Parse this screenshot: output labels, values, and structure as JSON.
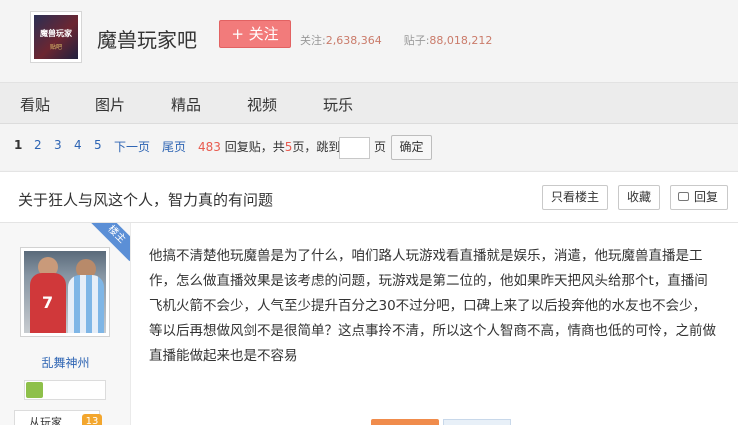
{
  "header": {
    "logo_text_main": "魔兽玩家",
    "logo_text_sub": "贴吧",
    "forum_name": "魔兽玩家吧",
    "follow_label": "+ 关注",
    "followers_label": "关注:",
    "followers_count": "2,638,364",
    "posts_label": "贴子:",
    "posts_count": "88,018,212"
  },
  "nav": {
    "tabs": [
      {
        "label": "看贴"
      },
      {
        "label": "图片"
      },
      {
        "label": "精品"
      },
      {
        "label": "视频"
      },
      {
        "label": "玩乐"
      }
    ]
  },
  "pager": {
    "pages": [
      "1",
      "2",
      "3",
      "4",
      "5"
    ],
    "next_label": "下一页",
    "last_label": "尾页",
    "reply_count": "483",
    "reply_suffix": "回复贴，共",
    "page_total": "5",
    "page_suffix": "页，跳到",
    "page_unit": "页",
    "go_label": "确定"
  },
  "thread": {
    "title": "关于狂人与风这个人，智力真的有问题",
    "only_op_label": "只看楼主",
    "favorite_label": "收藏",
    "reply_label": "回复"
  },
  "post": {
    "op_ribbon": "楼主",
    "author_name": "乱舞神州",
    "level_text": "从玩家",
    "level_num": "13",
    "content": "他搞不清楚他玩魔兽是为了什么，咱们路人玩游戏看直播就是娱乐，消遣，他玩魔兽直播是工作，怎么做直播效果是该考虑的问题，玩游戏是第二位的，他如果昨天把风头给那个t，直播间飞机火箭不会少，人气至少提升百分之30不过分吧，口碑上来了以后投奔他的水友也不会少，等以后再想做风剑不是很简单？这点事拎不清，所以这个人智商不高，情商也低的可怜，之前做直播能做起来也是不容易",
    "avatar_number": "7"
  },
  "colors": {
    "follow_button": "#f27b7b",
    "link_blue": "#2d64b3",
    "stat_number": "#ca7b6a",
    "op_ribbon": "#5b8fd6",
    "level_badge": "#f3a62d"
  }
}
